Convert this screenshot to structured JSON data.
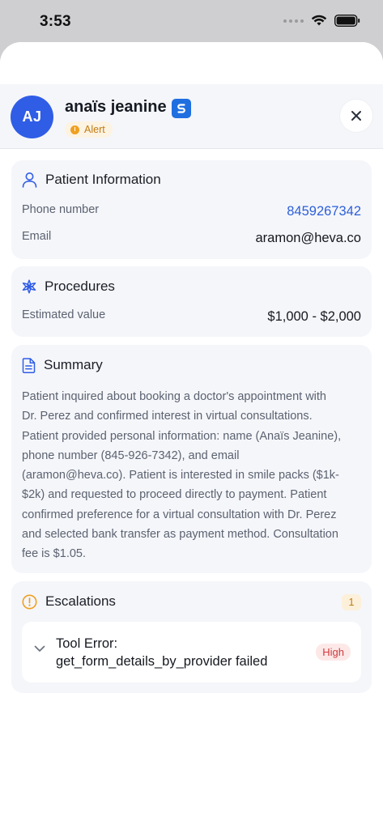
{
  "status_bar": {
    "time": "3:53",
    "icons": [
      "cellular-signal-icon",
      "wifi-icon",
      "battery-icon"
    ]
  },
  "header": {
    "avatar_initials": "AJ",
    "name": "anaïs jeanine",
    "name_icon": "app-logo-icon",
    "badge": "Alert",
    "close_icon": "close-icon"
  },
  "patient_info": {
    "title": "Patient Information",
    "icon": "person-icon",
    "phone_label": "Phone number",
    "phone_value": "8459267342",
    "email_label": "Email",
    "email_value": "aramon@heva.co"
  },
  "procedures": {
    "title": "Procedures",
    "icon": "asterisk-icon",
    "value_label": "Estimated value",
    "value": "$1,000 - $2,000"
  },
  "summary": {
    "title": "Summary",
    "icon": "document-icon",
    "lines": [
      "Patient inquired about booking a doctor's appointment with",
      "Dr. Perez and confirmed interest in virtual consultations.",
      "Patient provided personal information: name (Anaïs Jeanine),",
      "phone number (845-926-7342), and email",
      "(aramon@heva.co). Patient is interested in smile packs ($1k-",
      "$2k) and requested to proceed directly to payment. Patient",
      "confirmed preference for a virtual consultation with Dr. Perez",
      "and selected bank transfer as payment method. Consultation",
      "fee is $1.05."
    ]
  },
  "escalations": {
    "title": "Escalations",
    "icon": "alert-circle-icon",
    "count": "1",
    "items": [
      {
        "line1": "Tool Error:",
        "line2": "get_form_details_by_provider failed",
        "priority": "High"
      }
    ]
  },
  "colors": {
    "accent": "#2f5de6",
    "link": "#2c5fd8",
    "alert": "#f0a020",
    "high": "#d0393a"
  }
}
